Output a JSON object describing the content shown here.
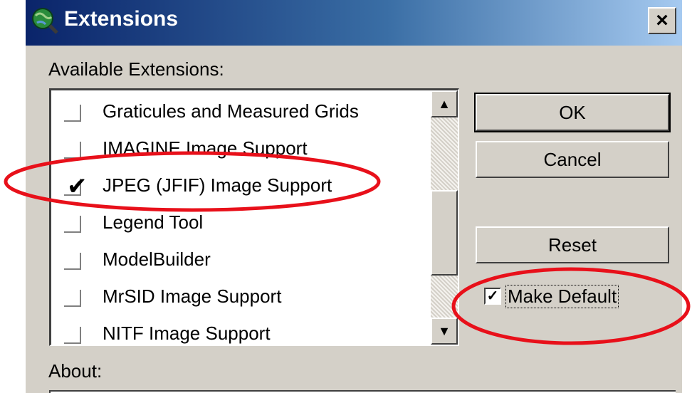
{
  "window": {
    "title": "Extensions",
    "icon": "globe-magnifier-icon",
    "close_glyph": "×"
  },
  "labels": {
    "available": "Available Extensions:",
    "about": "About:"
  },
  "extensions": [
    {
      "label": "Graticules and Measured Grids",
      "checked": false
    },
    {
      "label": "IMAGINE Image Support",
      "checked": false
    },
    {
      "label": "JPEG (JFIF) Image Support",
      "checked": true
    },
    {
      "label": "Legend Tool",
      "checked": false
    },
    {
      "label": "ModelBuilder",
      "checked": false
    },
    {
      "label": "MrSID Image Support",
      "checked": false
    },
    {
      "label": "NITF Image Support",
      "checked": false
    }
  ],
  "scrollbar": {
    "up_glyph": "▲",
    "down_glyph": "▼",
    "thumb_position": 0.4
  },
  "buttons": {
    "ok": "OK",
    "cancel": "Cancel",
    "reset": "Reset"
  },
  "make_default": {
    "label": "Make Default",
    "checked": true,
    "check_glyph": "✓"
  },
  "colors": {
    "dialog_bg": "#d4d0c8",
    "titlebar_start": "#0a246a",
    "titlebar_end": "#a6caf0",
    "annotation": "#e8101a"
  },
  "annotations": [
    "highlight-jpeg-extension",
    "highlight-make-default"
  ]
}
